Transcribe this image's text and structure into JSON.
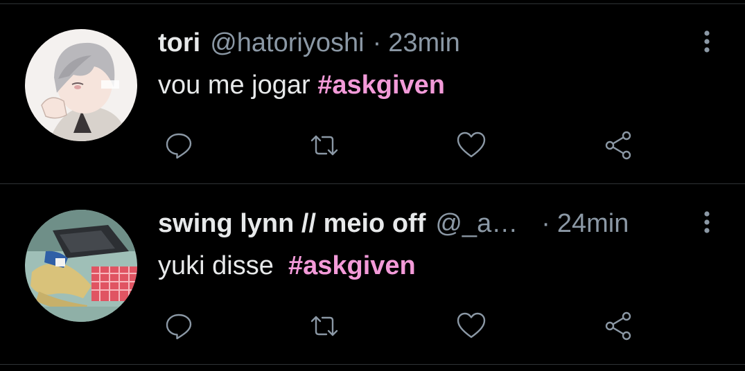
{
  "colors": {
    "background": "#000000",
    "text": "#e7e9ea",
    "muted": "#8b98a5",
    "hashtag": "#f29ad8",
    "divider": "#2f3336"
  },
  "tweets": [
    {
      "display_name": "tori",
      "handle": "@hatoriyoshi",
      "separator": "·",
      "time": "23min",
      "text": "vou me jogar ",
      "hashtag": "#askgiven",
      "avatar_icon": "anime-avatar-grey-hair",
      "actions": {
        "reply_icon": "reply-icon",
        "retweet_icon": "retweet-icon",
        "like_icon": "heart-icon",
        "share_icon": "share-icon"
      },
      "more_icon": "vertical-dots-icon"
    },
    {
      "display_name": "swing lynn // meio off",
      "handle": "@_a…",
      "separator": "·",
      "time": "24min",
      "text": "yuki disse  ",
      "hashtag": "#askgiven",
      "avatar_icon": "anime-avatar-lying-character",
      "actions": {
        "reply_icon": "reply-icon",
        "retweet_icon": "retweet-icon",
        "like_icon": "heart-icon",
        "share_icon": "share-icon"
      },
      "more_icon": "vertical-dots-icon"
    }
  ]
}
